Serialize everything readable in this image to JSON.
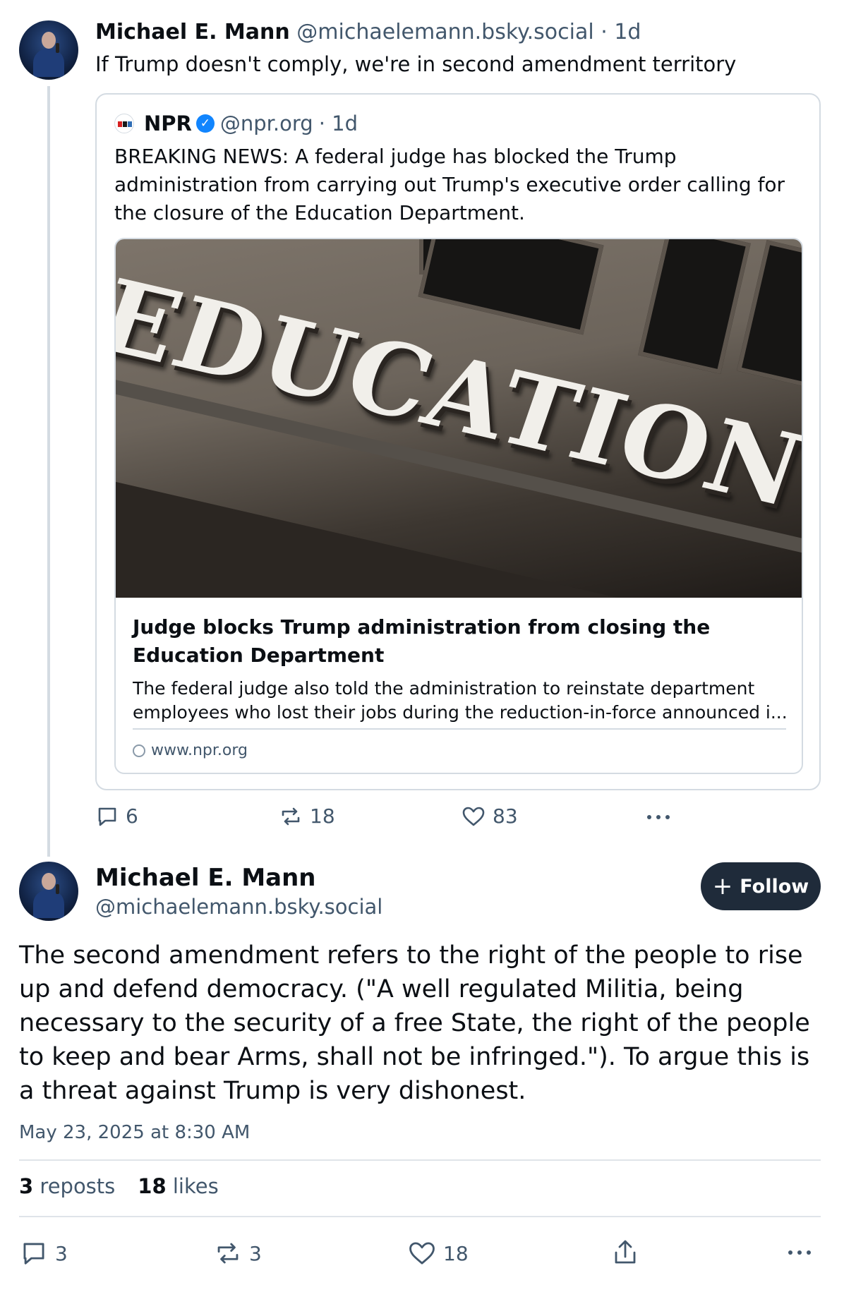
{
  "post1": {
    "author_name": "Michael E. Mann",
    "author_handle": "@michaelemann.bsky.social",
    "time": "· 1d",
    "text": "If Trump doesn't comply, we're in second amendment territory",
    "quote": {
      "author_name": "NPR",
      "author_handle": "@npr.org",
      "time": "· 1d",
      "text": "BREAKING NEWS: A federal judge has blocked the Trump administration from carrying out Trump's executive order calling for the closure of the Education Department.",
      "link": {
        "image_text": "EDUCATION",
        "title": "Judge blocks Trump administration from closing the Education Department",
        "description": "The federal judge also told the administration to reinstate department employees who lost their jobs during the reduction-in-force announced i...",
        "domain": "www.npr.org"
      }
    },
    "actions": {
      "replies": "6",
      "reposts": "18",
      "likes": "83"
    }
  },
  "post2": {
    "author_name": "Michael E. Mann",
    "author_handle": "@michaelemann.bsky.social",
    "follow_label": "Follow",
    "text": "The second amendment refers to the right of the people to rise up and defend democracy. (\"A well regulated Militia, being necessary to the security of a free State, the right of the people to keep and bear Arms, shall not be infringed.\"). To argue this is a threat against Trump is very dishonest.",
    "date": "May 23, 2025 at 8:30 AM",
    "stats": {
      "reposts_count": "3",
      "reposts_label": "reposts",
      "likes_count": "18",
      "likes_label": "likes"
    },
    "actions": {
      "replies": "3",
      "reposts": "3",
      "likes": "18"
    }
  },
  "colors": {
    "text": "#0b0f14",
    "muted": "#42576c",
    "border": "#d4dbe2",
    "verified": "#1185fe",
    "follow_bg": "#1f2b3a"
  },
  "icons": [
    "avatar",
    "npr-logo-icon",
    "verified-badge-icon",
    "globe-icon",
    "reply-icon",
    "repost-icon",
    "like-icon",
    "more-icon",
    "share-icon",
    "plus-icon"
  ]
}
